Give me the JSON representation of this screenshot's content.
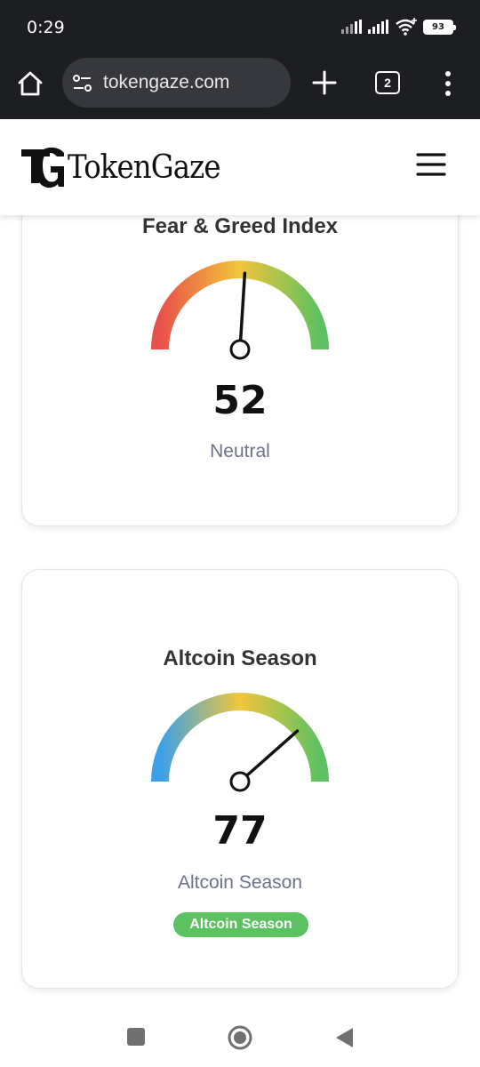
{
  "status_bar": {
    "time": "0:29",
    "battery": "93"
  },
  "browser": {
    "url": "tokengaze.com",
    "tab_count": "2"
  },
  "site": {
    "logo_text": "TokenGaze"
  },
  "fear_greed": {
    "title": "Fear & Greed Index",
    "value": "52",
    "label": "Neutral",
    "gauge_value": 52
  },
  "altcoin": {
    "title": "Altcoin Season",
    "value": "77",
    "label": "Altcoin Season",
    "badge": "Altcoin Season",
    "gauge_value": 77
  },
  "colors": {
    "fear": "#e8504a",
    "neutral": "#f2c63a",
    "greed": "#5cc160",
    "bitcoin": "#3aa0e8",
    "badge": "#5cc160"
  },
  "icons": [
    "home-icon",
    "tune-icon",
    "plus-icon",
    "tabs-icon",
    "more-vert-icon",
    "hamburger-icon",
    "nav-square-icon",
    "nav-home-icon",
    "nav-back-icon"
  ]
}
